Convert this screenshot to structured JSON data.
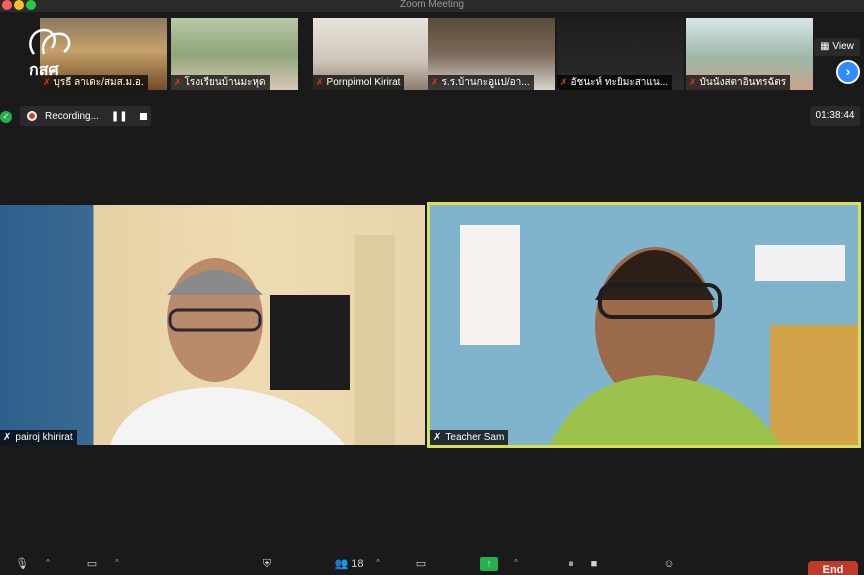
{
  "window": {
    "title": "Zoom Meeting"
  },
  "gallery": {
    "participants": [
      {
        "name": "บุรธี ลาเดะ/สมส.ม.อ."
      },
      {
        "name": "โรงเรียนบ้านมะหุด"
      },
      {
        "name": "Pornpimol Kirirat"
      },
      {
        "name": "ร.ร.บ้านกะอูแป/อา..."
      },
      {
        "name": "อัชนะห์ ทะยิมะสาแน..."
      },
      {
        "name": "บันนังสตาอินทรฉัตร"
      }
    ],
    "view_label": "View",
    "logo_text": "กสศ"
  },
  "recording": {
    "label": "Recording..."
  },
  "timer": "01:38:44",
  "speakers": {
    "left_name": "pairoj khirirat",
    "right_name": "Teacher Sam"
  },
  "toolbar": {
    "participants_count": "18",
    "end_label": "End"
  },
  "colors": {
    "active_speaker_border": "#d8e05a",
    "mute_red": "#e0352b",
    "accent_blue": "#2d8cff",
    "end_red": "#c0392b",
    "secure_green": "#23b14d"
  }
}
